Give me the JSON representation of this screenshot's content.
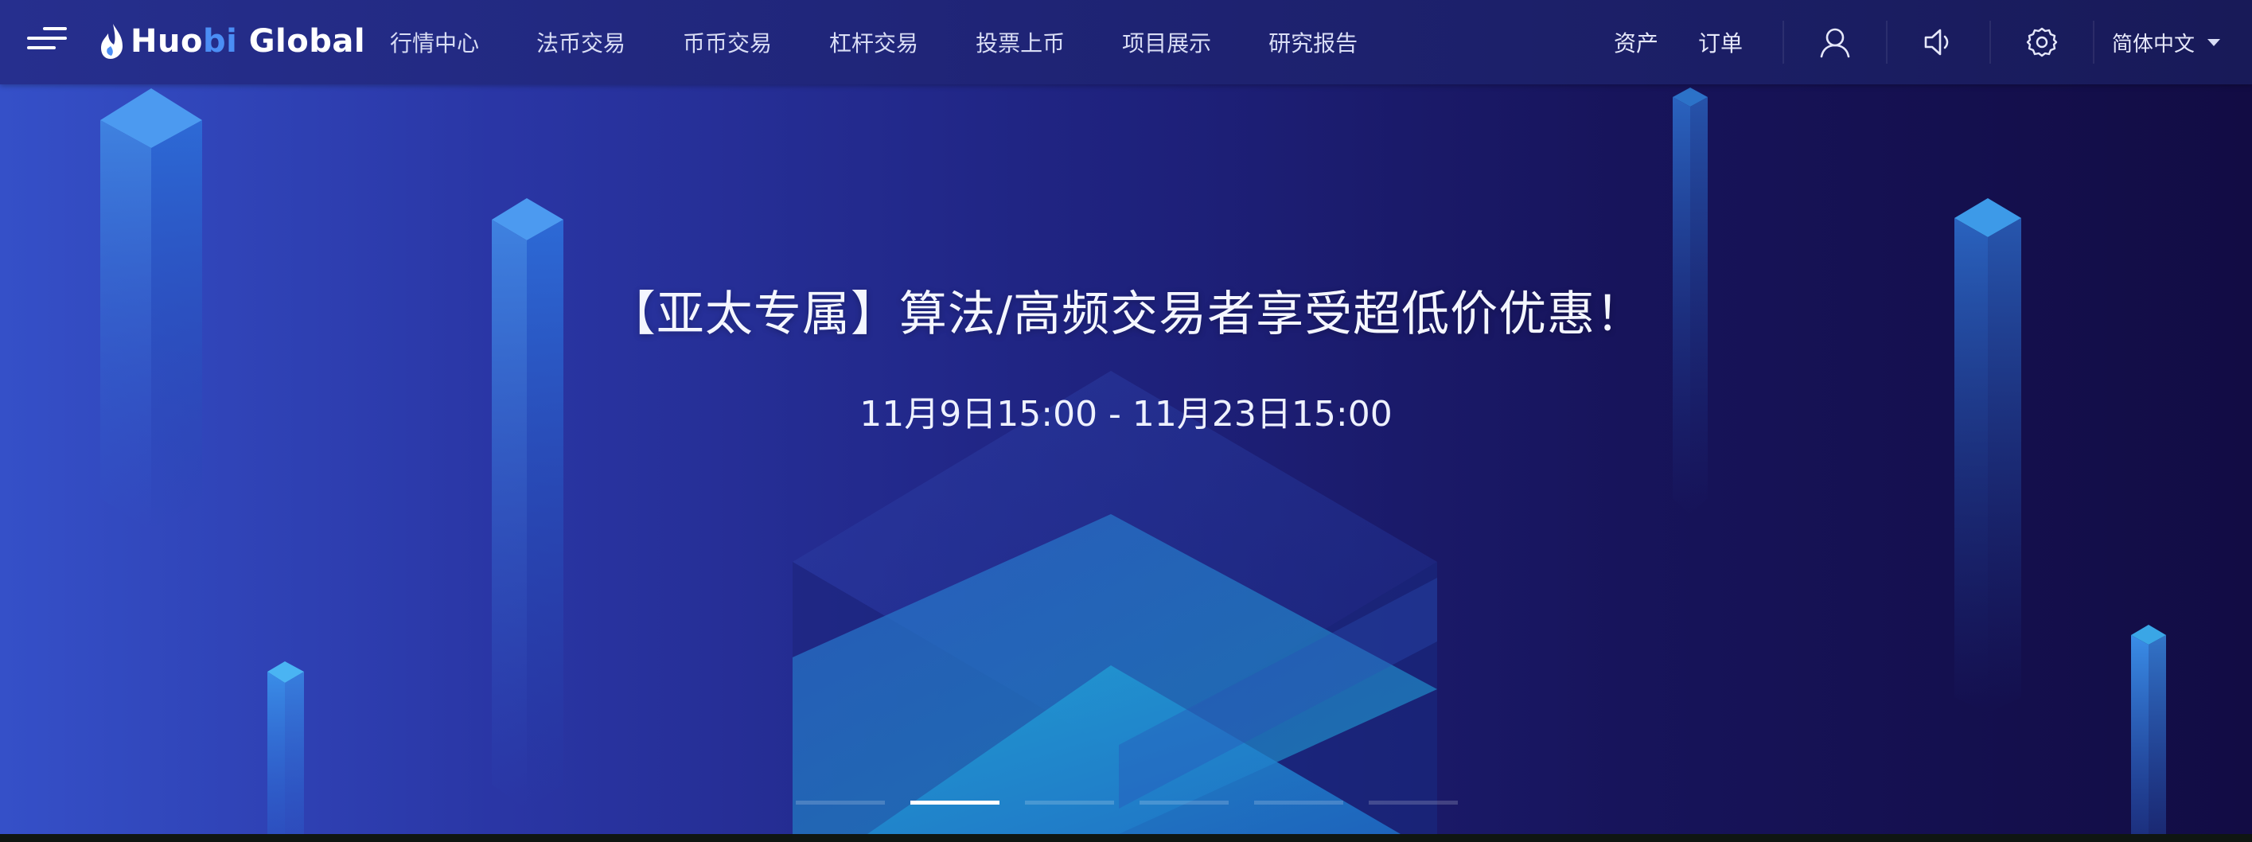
{
  "header": {
    "menu_icon": "hamburger-menu-icon",
    "logo": {
      "prefix": "Huo",
      "accent": "bi",
      "suffix": " Global",
      "icon": "flame-icon",
      "accent_color": "#4b8ef5"
    },
    "nav": [
      {
        "label": "行情中心"
      },
      {
        "label": "法币交易"
      },
      {
        "label": "币币交易"
      },
      {
        "label": "杠杆交易"
      },
      {
        "label": "投票上币"
      },
      {
        "label": "项目展示"
      },
      {
        "label": "研究报告"
      }
    ],
    "right_links": [
      {
        "label": "资产"
      },
      {
        "label": "订单"
      }
    ],
    "icons": {
      "user": "user-icon",
      "sound": "speaker-icon",
      "settings": "gear-icon"
    },
    "language": "简体中文"
  },
  "banner": {
    "title": "【亚太专属】算法/高频交易者享受超低价优惠！",
    "subtitle": "11月9日15:00 - 11月23日15:00",
    "slides_total": 6,
    "active_slide": 2
  },
  "colors": {
    "header_bg": "#262f8e",
    "banner_left": "#3550c8",
    "banner_right": "#120c44",
    "cube_cyan": "#36a6e8"
  }
}
